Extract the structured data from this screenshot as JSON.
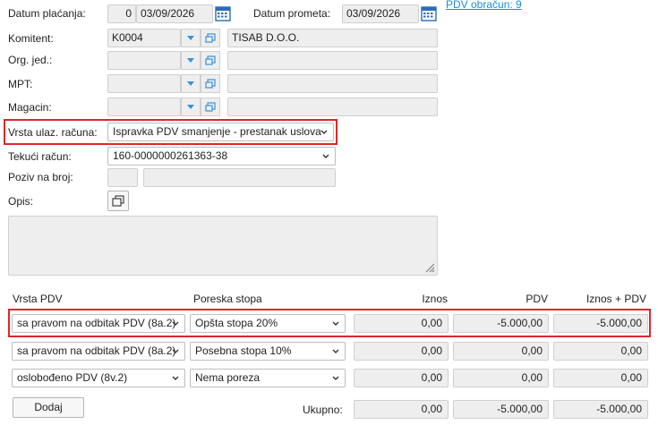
{
  "header": {
    "datum_placanja_label": "Datum plaćanja:",
    "datum_placanja_days": "0",
    "datum_placanja_value": "03/09/2026",
    "datum_prometa_label": "Datum prometa:",
    "datum_prometa_value": "03/09/2026",
    "pdv_link": "PDV obračun: 9"
  },
  "komitent": {
    "label": "Komitent:",
    "code": "K0004",
    "name": "TISAB D.O.O."
  },
  "org_jed": {
    "label": "Org. jed.:",
    "code": "",
    "name": ""
  },
  "mpt": {
    "label": "MPT:",
    "code": "",
    "name": ""
  },
  "magacin": {
    "label": "Magacin:",
    "code": "",
    "name": ""
  },
  "vrsta": {
    "label": "Vrsta ulaz. računa:",
    "value": "Ispravka PDV smanjenje - prestanak uslova"
  },
  "tekuci": {
    "label": "Tekući račun:",
    "value": "160-0000000261363-38"
  },
  "poziv": {
    "label": "Poziv na broj:",
    "model": "",
    "value": ""
  },
  "opis": {
    "label": "Opis:",
    "value": ""
  },
  "table": {
    "headers": {
      "vrsta": "Vrsta PDV",
      "stopa": "Poreska stopa",
      "iznos": "Iznos",
      "pdv": "PDV",
      "iznos_pdv": "Iznos + PDV"
    },
    "rows": [
      {
        "vrsta": "sa pravom na odbitak PDV (8a.2)",
        "stopa": "Opšta stopa 20%",
        "iznos": "0,00",
        "pdv": "-5.000,00",
        "iznos_pdv": "-5.000,00"
      },
      {
        "vrsta": "sa pravom na odbitak PDV (8a.2)",
        "stopa": "Posebna stopa 10%",
        "iznos": "0,00",
        "pdv": "0,00",
        "iznos_pdv": "0,00"
      },
      {
        "vrsta": "oslobođeno PDV (8v.2)",
        "stopa": "Nema poreza",
        "iznos": "0,00",
        "pdv": "0,00",
        "iznos_pdv": "0,00"
      }
    ]
  },
  "footer": {
    "dodaj_label": "Dodaj",
    "ukupno_label": "Ukupno:",
    "ukupno_iznos": "0,00",
    "ukupno_pdv": "-5.000,00",
    "ukupno_iznos_pdv": "-5.000,00"
  },
  "colors": {
    "highlight": "#e0262b",
    "link": "#1a8fd6",
    "calendar": "#2b6db5",
    "combo_arrow": "#3b8fd9"
  }
}
